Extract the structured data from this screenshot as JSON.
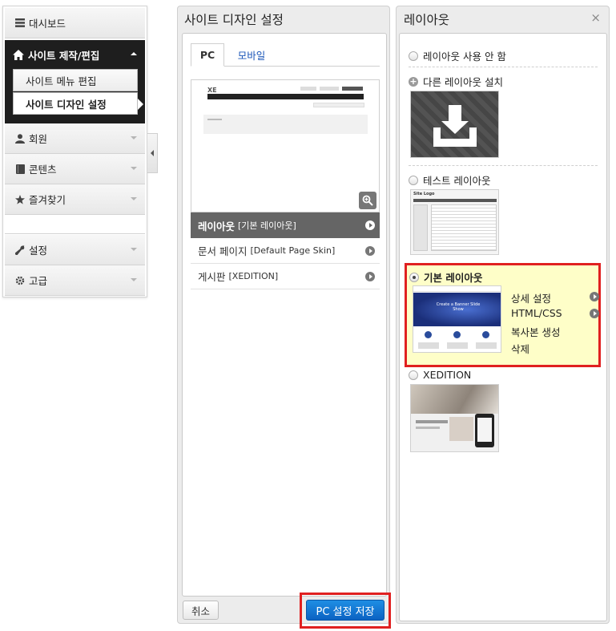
{
  "sidebar": {
    "dashboard": "대시보드",
    "active_menu": {
      "title": "사이트 제작/편집",
      "sub_items": [
        {
          "label": "사이트 메뉴 편집"
        },
        {
          "label": "사이트 디자인 설정"
        }
      ]
    },
    "members": "회원",
    "contents": "콘텐츠",
    "favorites": "즐겨찾기",
    "settings": "설정",
    "advanced": "고급"
  },
  "design_panel": {
    "title": "사이트 디자인 설정",
    "tabs": [
      {
        "label": "PC",
        "active": true
      },
      {
        "label": "모바일",
        "active": false
      }
    ],
    "preview_logo": "XE",
    "rows": [
      {
        "label": "레이아웃",
        "value": "[기본 레이아웃]"
      },
      {
        "label": "문서 페이지",
        "value": "[Default Page Skin]"
      },
      {
        "label": "게시판",
        "value": "[XEDITION]"
      }
    ],
    "cancel_label": "취소",
    "save_label": "PC 설정 저장"
  },
  "layout_panel": {
    "title": "레이아웃",
    "close": "×",
    "options": {
      "none": "레이아웃 사용 안 함",
      "install": "다른 레이아웃 설치",
      "test": "테스트 레이아웃",
      "basic": "기본 레이아웃",
      "xedition": "XEDITION"
    },
    "test_thumb_title": "Site Logo",
    "basic_thumb_text": "Create a Banner Slide Show",
    "basic_actions": [
      "상세 설정",
      "HTML/CSS",
      "복사본 생성",
      "삭제"
    ]
  },
  "colors": {
    "save_button": "#0b62c2",
    "highlight_border": "#e02020",
    "selected_layout_bg": "#fefec8",
    "sidebar_active_bg": "#1e1e1e"
  }
}
